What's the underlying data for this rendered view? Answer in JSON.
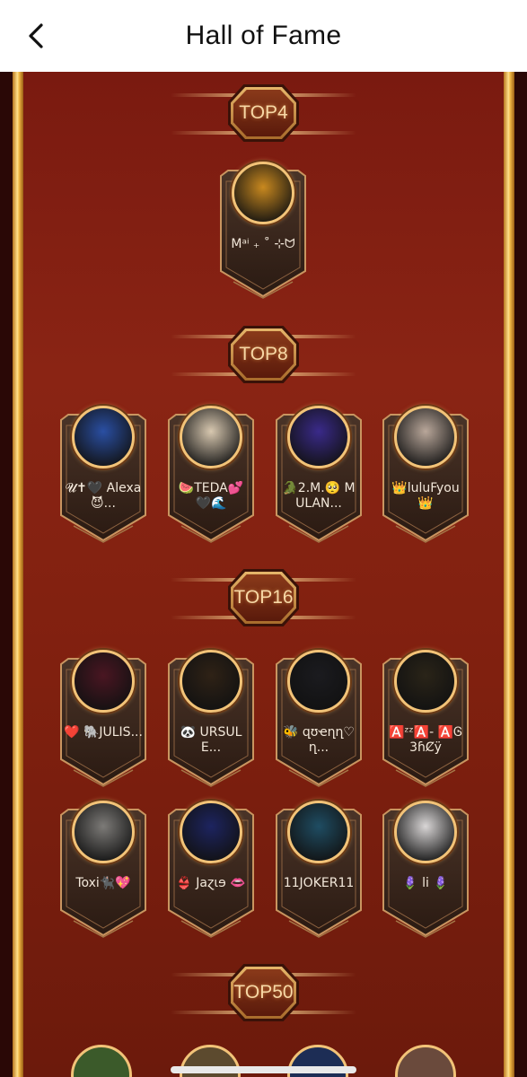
{
  "header": {
    "title": "Hall of Fame",
    "back_icon": "chevron-left-icon"
  },
  "sections": [
    {
      "label": "TOP4",
      "members": [
        {
          "name": "Mᵃⁱ ₊ ˚ ⊹ᗢ",
          "avatar_color": "#c9891f"
        }
      ]
    },
    {
      "label": "TOP8",
      "members": [
        {
          "name": "𝓤✝🖤 Alexa😈...",
          "avatar_color": "#2a4fa3"
        },
        {
          "name": "🍉TEDA💕 🖤🌊",
          "avatar_color": "#d8c8b0"
        },
        {
          "name": "🐊2.M.🥺 MULAN...",
          "avatar_color": "#3a2a8a"
        },
        {
          "name": "👑luluFyou 👑",
          "avatar_color": "#b9a79a"
        }
      ]
    },
    {
      "label": "TOP16",
      "members": [
        {
          "name": "❤️ 🐘JULIS...",
          "avatar_color": "#4a1622"
        },
        {
          "name": "🐼 URSULE...",
          "avatar_color": "#2f2216"
        },
        {
          "name": "🐝 զʊҽղղ♡ղ...",
          "avatar_color": "#1b1b1f"
        },
        {
          "name": "🅰️ᶻᶻ🅰️- 🅰️Ꮆ3ɦȻÿ",
          "avatar_color": "#2a2418"
        },
        {
          "name": "Toxi🐈‍⬛💖",
          "avatar_color": "#7d7b78"
        },
        {
          "name": "👙 Jaɀɩɘ 👄",
          "avatar_color": "#1d2460"
        },
        {
          "name": "11JOKER11",
          "avatar_color": "#1f4d63"
        },
        {
          "name": "🪻 li 🪻",
          "avatar_color": "#d9d6d6"
        }
      ]
    },
    {
      "label": "TOP50",
      "members": []
    }
  ]
}
